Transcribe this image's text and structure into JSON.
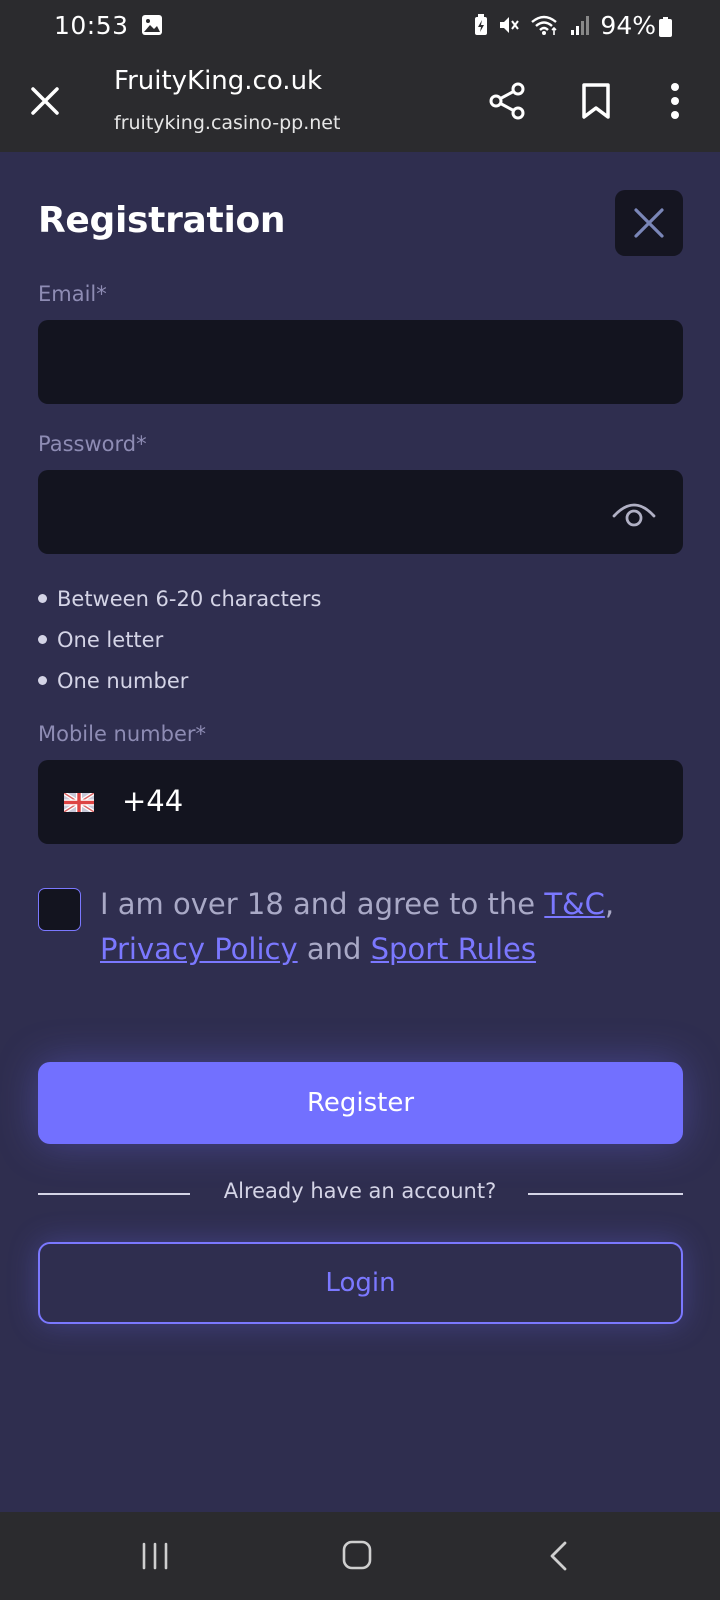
{
  "status_bar": {
    "time": "10:53",
    "battery": "94%",
    "icons": [
      "image-icon",
      "battery-saver-icon",
      "mute-icon",
      "wifi-icon",
      "signal-icon",
      "battery-icon"
    ]
  },
  "browser": {
    "title": "FruityKing.co.uk",
    "url": "fruityking.casino-pp.net",
    "icons": [
      "close-icon",
      "share-icon",
      "bookmark-icon",
      "more-vert-icon"
    ]
  },
  "form": {
    "title": "Registration",
    "email": {
      "label": "Email*",
      "value": "",
      "placeholder": ""
    },
    "password": {
      "label": "Password*",
      "value": "",
      "placeholder": ""
    },
    "password_rules": [
      "Between 6-20 characters",
      "One letter",
      "One number"
    ],
    "mobile": {
      "label": "Mobile number*",
      "country_code": "+44",
      "flag": "uk-flag-icon"
    },
    "agreement": {
      "prefix": "I am over 18 and agree to the ",
      "tc": "T&C",
      "comma": ",",
      "privacy": "Privacy Policy",
      "and": " and ",
      "sport_rules": "Sport Rules",
      "checked": false
    },
    "register_label": "Register",
    "divider_text": "Already have an account?",
    "login_label": "Login"
  },
  "colors": {
    "page_bg": "#2f2e4f",
    "field_bg": "#13141f",
    "accent": "#7270ff",
    "chrome_bg": "#2b2b2e"
  }
}
